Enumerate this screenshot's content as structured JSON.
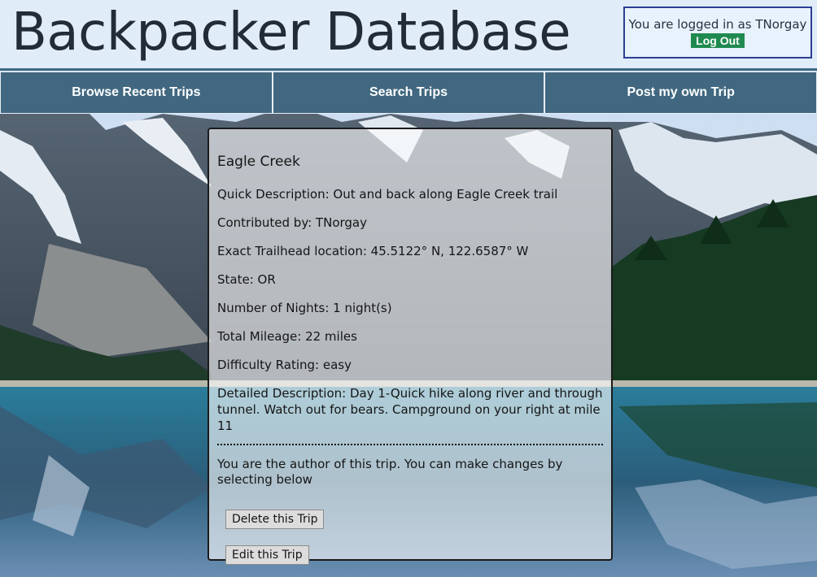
{
  "header": {
    "site_title": "Backpacker Database",
    "login_text": "You are logged in as TNorgay",
    "logout_label": "Log Out"
  },
  "nav": {
    "items": [
      {
        "label": "Browse Recent Trips"
      },
      {
        "label": "Search Trips"
      },
      {
        "label": "Post my own Trip"
      }
    ]
  },
  "trip": {
    "name": "Eagle Creek",
    "quick_description": "Quick Description: Out and back along Eagle Creek trail",
    "contributed_by": "Contributed by: TNorgay",
    "trailhead": "Exact Trailhead location: 45.5122° N, 122.6587° W",
    "state": "State: OR",
    "nights": "Number of Nights: 1 night(s)",
    "mileage": "Total Mileage: 22 miles",
    "difficulty": "Difficulty Rating: easy",
    "detailed_description": "Detailed Description: Day 1-Quick hike along river and through tunnel. Watch out for bears. Campground on your right at mile 11"
  },
  "author_section": {
    "note": "You are the author of this trip. You can make changes by selecting below",
    "delete_label": "Delete this Trip",
    "edit_label": "Edit this Trip"
  },
  "colors": {
    "nav_background": "#345e76",
    "logout_button": "#1f8a4f",
    "login_border": "#2c3e92",
    "header_rule": "#3d6a86"
  }
}
